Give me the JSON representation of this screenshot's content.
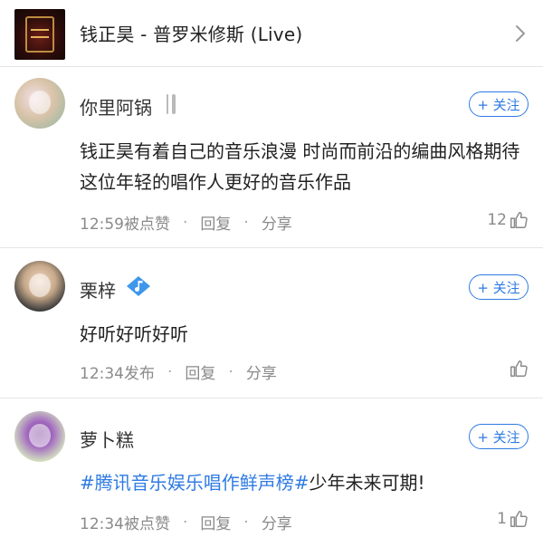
{
  "song": {
    "title": "钱正昊 - 普罗米修斯 (Live)",
    "cover_icon": "album-cover",
    "chevron_icon": "chevron-right-icon"
  },
  "colors": {
    "accent": "#2f7be3",
    "meta_text": "#8a8a8a",
    "divider": "#e6e6e6"
  },
  "comments": [
    {
      "username": "你里阿锅",
      "badge_icon": "fork-knife-icon",
      "follow_label": "+ 关注",
      "content": "钱正昊有着自己的音乐浪漫 时尚而前沿的编曲风格期待这位年轻的唱作人更好的音乐作品",
      "time": "12:59被点赞",
      "reply_label": "回复",
      "share_label": "分享",
      "likes": "12"
    },
    {
      "username": "栗梓",
      "badge_icon": "music-note-diamond-icon",
      "follow_label": "+ 关注",
      "content": "好听好听好听",
      "time": "12:34发布",
      "reply_label": "回复",
      "share_label": "分享",
      "likes": ""
    },
    {
      "username": "萝卜糕",
      "follow_label": "+ 关注",
      "hashtag": "#腾讯音乐娱乐唱作鲜声榜#",
      "content_rest": "少年未来可期!",
      "time": "12:34被点赞",
      "reply_label": "回复",
      "share_label": "分享",
      "likes": "1"
    }
  ]
}
